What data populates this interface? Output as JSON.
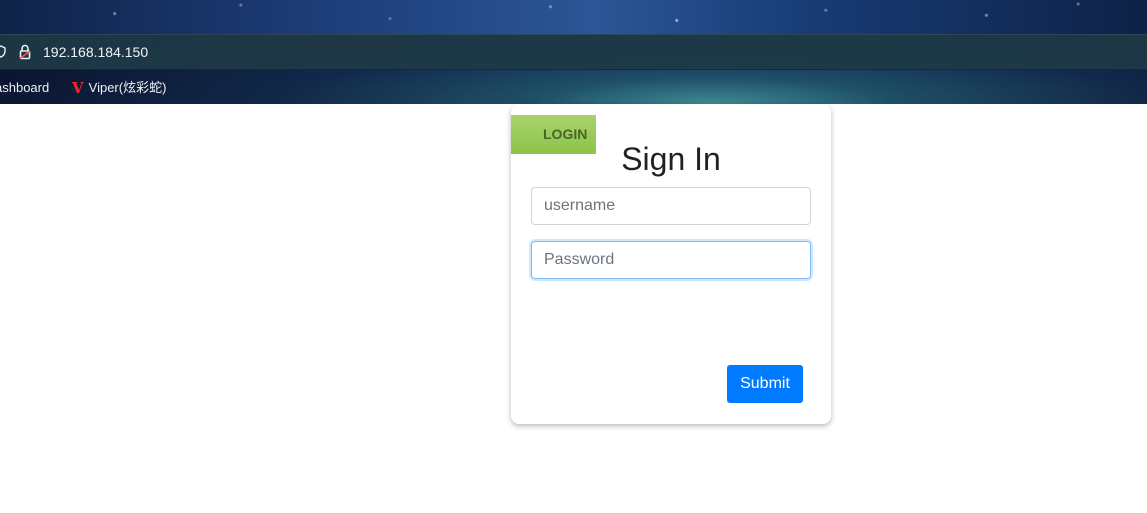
{
  "browser": {
    "address_bar": {
      "url": "192.168.184.150"
    },
    "bookmarks": [
      {
        "label": "ashboard"
      },
      {
        "label": "Viper(炫彩蛇)",
        "icon": "viper-v-icon"
      }
    ]
  },
  "login": {
    "ribbon_label": "LOGIN",
    "title": "Sign In",
    "username_placeholder": "username",
    "password_placeholder": "Password",
    "submit_label": "Submit",
    "colors": {
      "ribbon": "#8cc34b",
      "submit": "#007bff",
      "focus_border": "#80bdff"
    }
  }
}
